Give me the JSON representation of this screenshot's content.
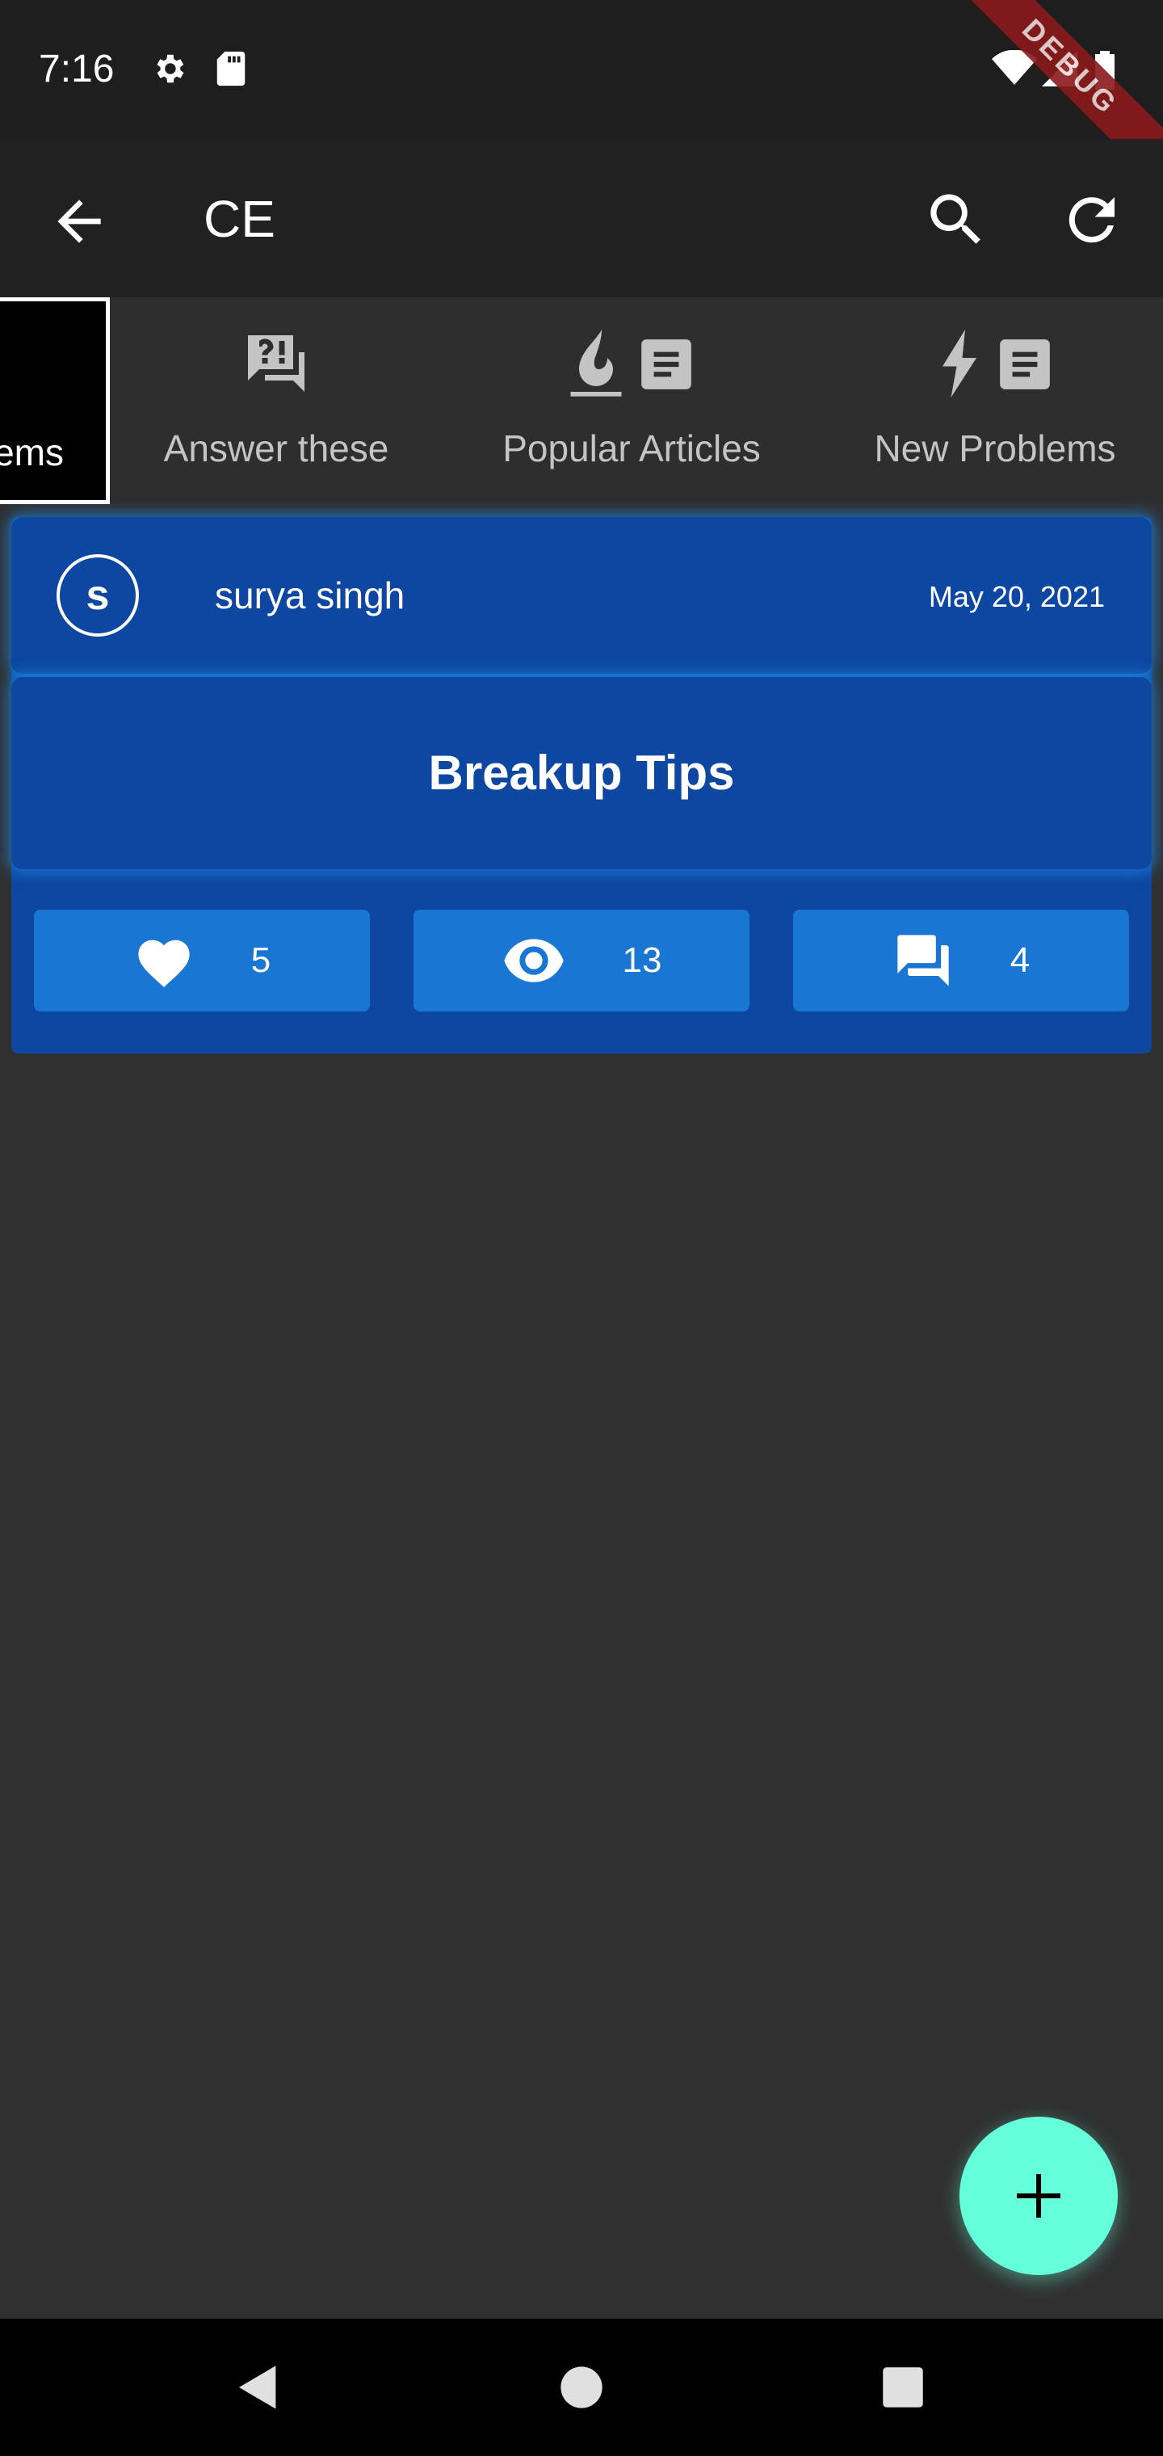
{
  "status_bar": {
    "time": "7:16",
    "debug_label": "DEBUG"
  },
  "app_bar": {
    "title": "CE"
  },
  "tabs": [
    {
      "label": "Problems",
      "visible_label": "ems",
      "active": true
    },
    {
      "label": "Answer these",
      "active": false
    },
    {
      "label": "Popular Articles",
      "active": false
    },
    {
      "label": "New Problems",
      "active": false
    }
  ],
  "post": {
    "avatar_letter": "s",
    "author": "surya singh",
    "date": "May 20, 2021",
    "title": "Breakup Tips",
    "likes": "5",
    "views": "13",
    "comments": "4"
  },
  "colors": {
    "background": "#303030",
    "app_bar": "#212121",
    "card": "#0d47a1",
    "stat_button": "#1976d2",
    "fab": "#64ffda",
    "glow": "#1e88e5"
  },
  "icons": [
    "back-arrow-icon",
    "search-icon",
    "refresh-icon",
    "question-chat-icon",
    "fire-article-icon",
    "bolt-article-icon",
    "heart-icon",
    "eye-icon",
    "forum-icon",
    "add-icon"
  ]
}
